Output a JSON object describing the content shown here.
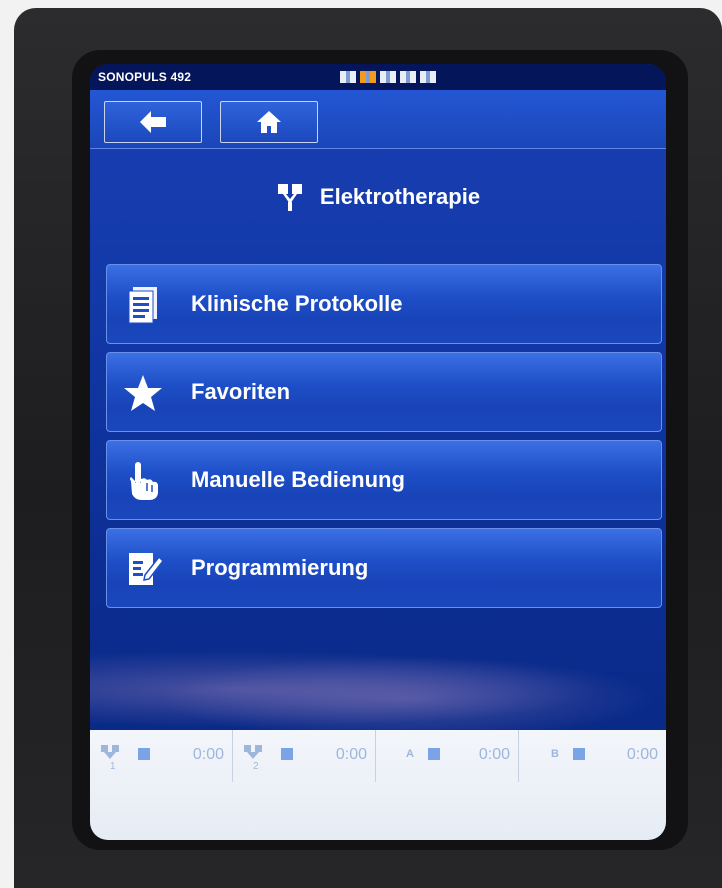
{
  "device": {
    "name": "SONOPULS 492"
  },
  "channels": {
    "count": 5,
    "active_index": 1
  },
  "nav": {
    "back_icon": "back-arrow-icon",
    "home_icon": "home-icon"
  },
  "page": {
    "title": "Elektrotherapie",
    "title_icon": "electrode-icon"
  },
  "menu": [
    {
      "label": "Klinische Protokolle",
      "icon": "document-icon"
    },
    {
      "label": "Favoriten",
      "icon": "star-icon"
    },
    {
      "label": "Manuelle Bedienung",
      "icon": "hand-pointer-icon"
    },
    {
      "label": "Programmierung",
      "icon": "edit-document-icon"
    }
  ],
  "status": [
    {
      "icon": "electrode-channel-1-icon",
      "time": "0:00"
    },
    {
      "icon": "electrode-channel-2-icon",
      "time": "0:00"
    },
    {
      "letter": "A",
      "time": "0:00"
    },
    {
      "letter": "B",
      "time": "0:00"
    }
  ],
  "colors": {
    "screen_blue": "#1239a8",
    "active_channel": "#f29a1e"
  }
}
